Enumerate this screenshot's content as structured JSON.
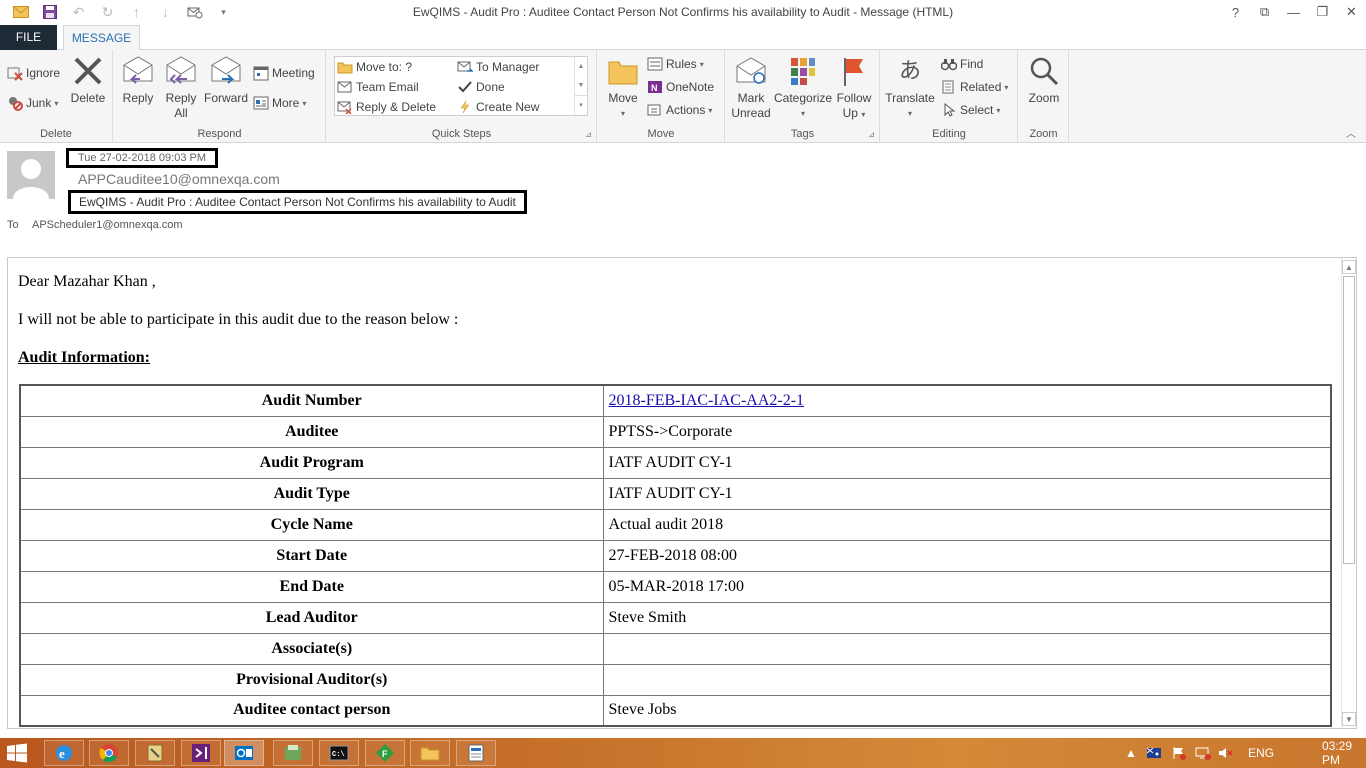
{
  "window": {
    "title": "EwQIMS - Audit Pro : Auditee Contact Person Not Confirms his availability to Audit - Message (HTML)"
  },
  "qat": {
    "icons": [
      "mail-icon",
      "save-icon",
      "undo-icon",
      "redo-icon",
      "up-icon",
      "down-icon",
      "send-receive-icon",
      "customize-icon"
    ]
  },
  "tabs": {
    "file": "FILE",
    "message": "MESSAGE"
  },
  "ribbon": {
    "delete_group": {
      "label": "Delete",
      "ignore": "Ignore",
      "junk": "Junk",
      "delete": "Delete"
    },
    "respond_group": {
      "label": "Respond",
      "reply": "Reply",
      "reply_all_1": "Reply",
      "reply_all_2": "All",
      "forward": "Forward",
      "meeting": "Meeting",
      "more": "More"
    },
    "quick_steps_group": {
      "label": "Quick Steps",
      "move_to": "Move to: ?",
      "to_manager": "To Manager",
      "team_email": "Team Email",
      "done": "Done",
      "reply_delete": "Reply & Delete",
      "create_new": "Create New"
    },
    "move_group": {
      "label": "Move",
      "move": "Move",
      "rules": "Rules",
      "onenote": "OneNote",
      "actions": "Actions"
    },
    "tags_group": {
      "label": "Tags",
      "mark_unread_1": "Mark",
      "mark_unread_2": "Unread",
      "categorize": "Categorize",
      "follow_up_1": "Follow",
      "follow_up_2": "Up"
    },
    "editing_group": {
      "label": "Editing",
      "translate": "Translate",
      "find": "Find",
      "related": "Related",
      "select": "Select"
    },
    "zoom_group": {
      "label": "Zoom",
      "zoom": "Zoom"
    }
  },
  "header": {
    "date": "Tue 27-02-2018 09:03 PM",
    "from": "APPCauditee10@omnexqa.com",
    "subject": "EwQIMS - Audit Pro : Auditee Contact Person Not Confirms his availability to Audit",
    "to_label": "To",
    "to": "APScheduler1@omnexqa.com"
  },
  "body": {
    "greeting": "Dear Mazahar Khan ,",
    "reason": "I will not be able to participate in this audit due to the reason below :",
    "audit_info_heading": "Audit Information:",
    "rows": [
      {
        "key": "Audit Number",
        "value": "2018-FEB-IAC-IAC-AA2-2-1"
      },
      {
        "key": "Auditee",
        "value": "PPTSS->Corporate"
      },
      {
        "key": "Audit Program",
        "value": "IATF AUDIT CY-1"
      },
      {
        "key": "Audit Type",
        "value": "IATF AUDIT CY-1"
      },
      {
        "key": "Cycle Name",
        "value": "Actual audit 2018"
      },
      {
        "key": "Start Date",
        "value": "27-FEB-2018 08:00"
      },
      {
        "key": "End Date",
        "value": "05-MAR-2018 17:00"
      },
      {
        "key": "Lead Auditor",
        "value": "Steve Smith"
      },
      {
        "key": "Associate(s)",
        "value": ""
      },
      {
        "key": "Provisional Auditor(s)",
        "value": ""
      },
      {
        "key": "Auditee contact person",
        "value": "Steve Jobs"
      }
    ]
  },
  "taskbar": {
    "apps": [
      "internet-explorer-icon",
      "chrome-icon",
      "tools-icon",
      "visual-studio-icon",
      "outlook-icon",
      "file-manager-icon",
      "cmd-icon",
      "green-app-icon",
      "explorer-folder-icon",
      "document-icon"
    ],
    "language": "ENG",
    "time": "03:29 PM"
  },
  "colors": {
    "file_tab": "#1e2a36",
    "message_tab_text": "#2a6fb5",
    "link": "#1a0dab",
    "taskbar": "#c6702a"
  }
}
